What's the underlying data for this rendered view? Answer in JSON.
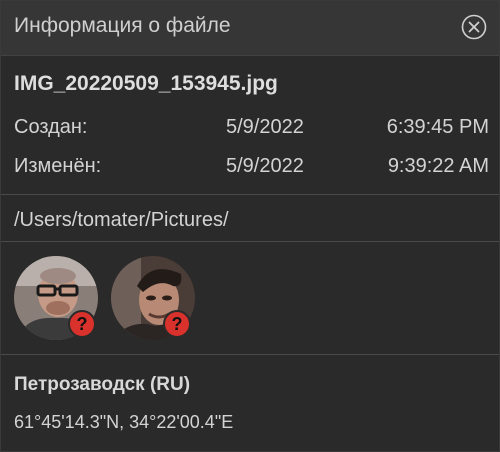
{
  "panel": {
    "title": "Информация о файле",
    "close_icon": "close-circle-icon"
  },
  "file": {
    "name": "IMG_20220509_153945.jpg",
    "created": {
      "label": "Создан:",
      "date": "5/9/2022",
      "time": "6:39:45 PM"
    },
    "modified": {
      "label": "Изменён:",
      "date": "5/9/2022",
      "time": "9:39:22 AM"
    },
    "path": "/Users/tomater/Pictures/"
  },
  "faces": [
    {
      "icon": "person-avatar",
      "badge_icon": "question-badge-icon",
      "badge_color": "#d9312b"
    },
    {
      "icon": "person-avatar",
      "badge_icon": "question-badge-icon",
      "badge_color": "#d9312b"
    }
  ],
  "location": {
    "place": "Петрозаводск (RU)",
    "coordinates": "61°45'14.3\"N, 34°22'00.4\"E"
  },
  "colors": {
    "background": "#2a2a2a",
    "header": "#363636",
    "divider": "#4a4a4a",
    "badge": "#d9312b"
  }
}
